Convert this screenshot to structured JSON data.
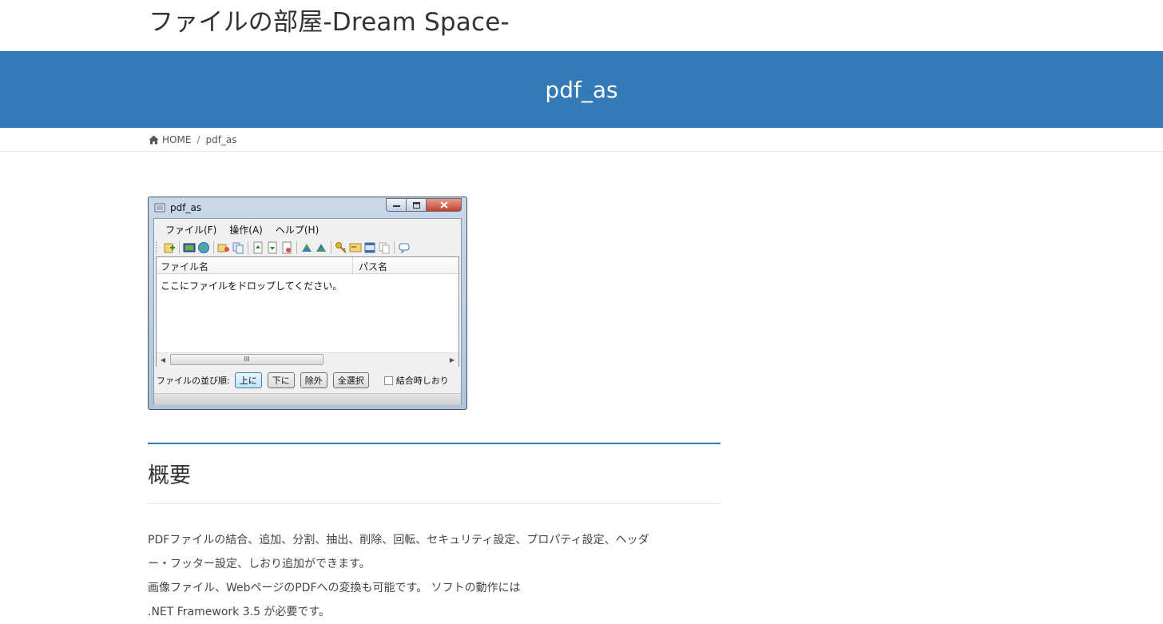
{
  "site": {
    "title": "ファイルの部屋-Dream Space-"
  },
  "banner": {
    "title": "pdf_as"
  },
  "breadcrumb": {
    "home": "HOME",
    "separator": "/",
    "current": "pdf_as"
  },
  "app": {
    "title": "pdf_as",
    "menu": [
      "ファイル(F)",
      "操作(A)",
      "ヘルプ(H)"
    ],
    "columns": [
      "ファイル名",
      "パス名"
    ],
    "empty_message": "ここにファイルをドロップしてください。",
    "scroll_thumb": "III",
    "order_label": "ファイルの並び順:",
    "buttons": [
      "上に",
      "下に",
      "除外",
      "全選択"
    ],
    "checkbox_label": "結合時しおり"
  },
  "section": {
    "title": "概要",
    "lines": [
      "PDFファイルの結合、追加、分割、抽出、削除、回転、セキュリティ設定、プロパティ設定、ヘッダ",
      "ー・フッター設定、しおり追加ができます。",
      "画像ファイル、WebページのPDFへの変換も可能です。 ソフトの動作には",
      ".NET Framework 3.5 が必要です。"
    ]
  },
  "colors": {
    "accent": "#337ab7",
    "text": "#333333"
  }
}
